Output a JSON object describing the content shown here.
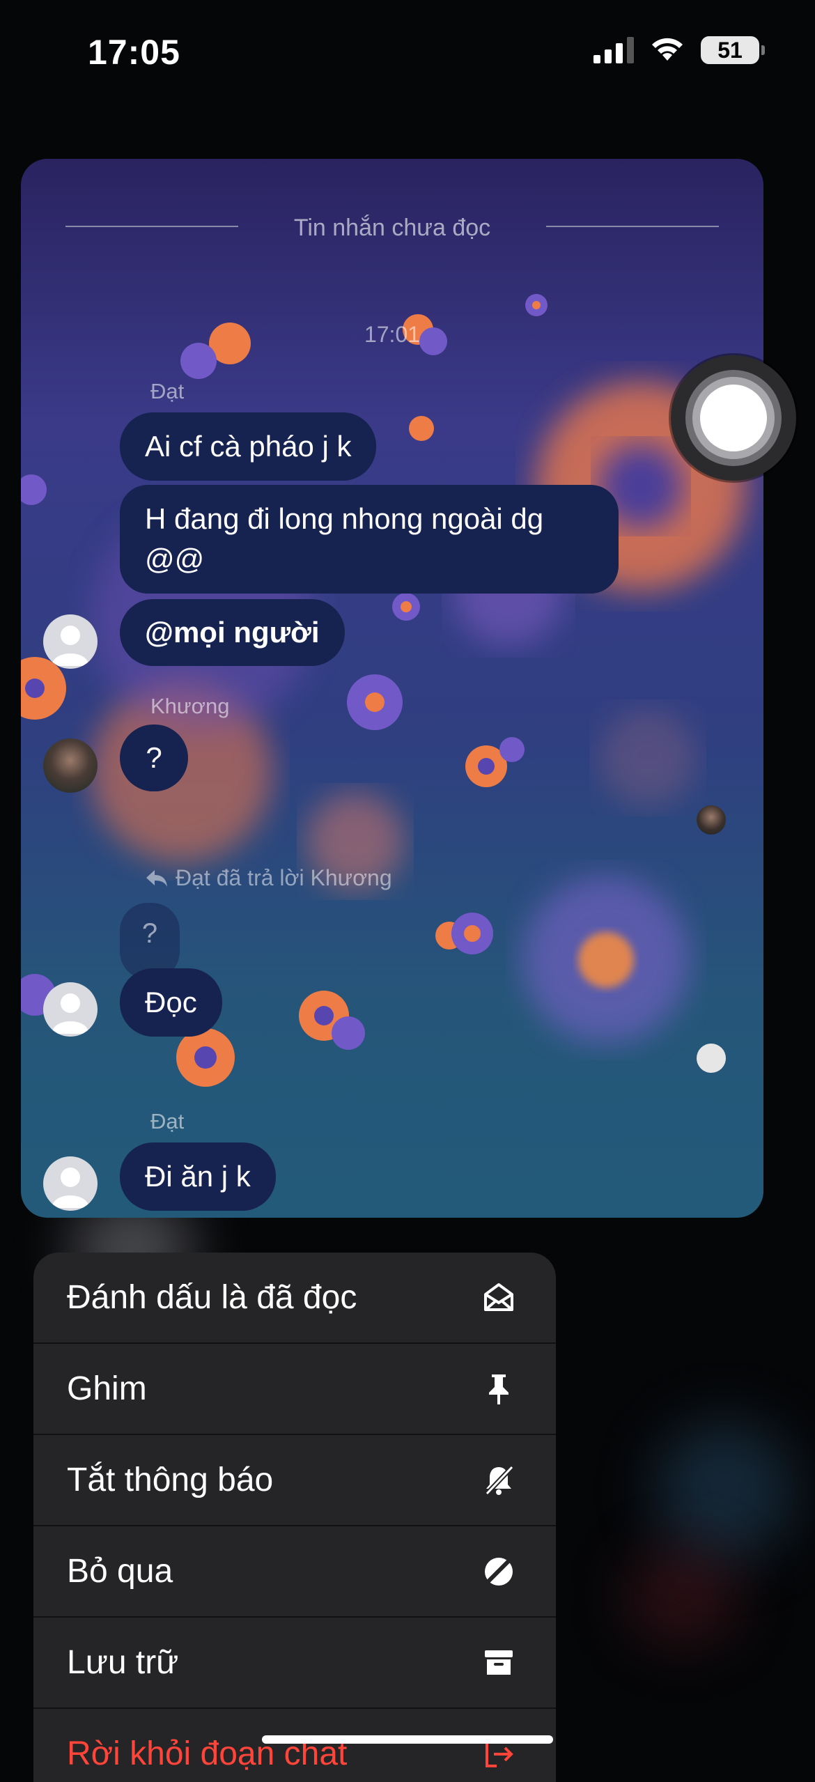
{
  "status_bar": {
    "time": "17:05",
    "battery": "51"
  },
  "chat": {
    "unread_divider": "Tin nhắn chưa đọc",
    "timestamp": "17:01",
    "sender_1": "Đạt",
    "messages_1": [
      "Ai cf cà pháo j k",
      "H đang đi long nhong ngoài dg @@",
      "@mọi người"
    ],
    "sender_2": "Khương",
    "message_2": "?",
    "reply_note": "Đạt đã trả lời Khương",
    "quoted_message": "?",
    "reply_message": "Đọc",
    "sender_3": "Đạt",
    "message_3": "Đi ăn j k"
  },
  "menu": {
    "items": [
      {
        "label": "Đánh dấu là đã đọc",
        "icon": "envelope-open-icon"
      },
      {
        "label": "Ghim",
        "icon": "pin-icon"
      },
      {
        "label": "Tắt thông báo",
        "icon": "bell-slash-icon"
      },
      {
        "label": "Bỏ qua",
        "icon": "ignore-slash-icon"
      },
      {
        "label": "Lưu trữ",
        "icon": "archive-box-icon"
      },
      {
        "label": "Rời khỏi đoạn chat",
        "icon": "leave-chat-icon"
      }
    ],
    "danger_color": "#ff453a"
  }
}
